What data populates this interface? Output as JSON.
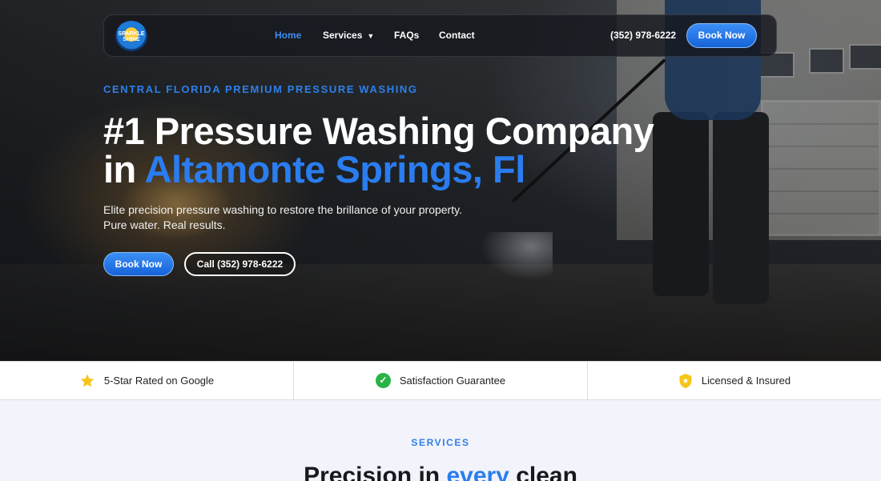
{
  "nav": {
    "logo_text": "SPARKLE SHINE",
    "links": [
      {
        "label": "Home"
      },
      {
        "label": "Services"
      },
      {
        "label": "FAQs"
      },
      {
        "label": "Contact"
      }
    ],
    "phone": "(352) 978-6222",
    "cta_label": "Book Now"
  },
  "hero": {
    "eyebrow": "CENTRAL FLORIDA PREMIUM PRESSURE WASHING",
    "headline_line1": "#1 Pressure Washing Company",
    "headline_prefix": "in ",
    "headline_accent": "Altamonte Springs, Fl",
    "subtext_line1": "Elite precision pressure washing to restore the brillance of your property.",
    "subtext_line2": "Pure water. Real results.",
    "primary_cta": "Book Now",
    "secondary_cta": "Call (352) 978-6222"
  },
  "trust": {
    "items": [
      {
        "icon": "star-icon",
        "label": "5-Star Rated on Google"
      },
      {
        "icon": "check-circle-icon",
        "label": "Satisfaction Guarantee"
      },
      {
        "icon": "shield-icon",
        "label": "Licensed & Insured"
      }
    ]
  },
  "services": {
    "eyebrow": "SERVICES",
    "title_prefix": "Precision in ",
    "title_accent": "every",
    "title_suffix": " clean"
  },
  "colors": {
    "accent": "#2a7df0",
    "check": "#28b347",
    "star": "#f5c518"
  }
}
